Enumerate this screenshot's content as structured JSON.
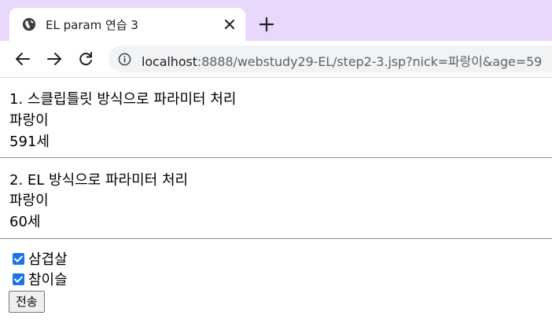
{
  "browser": {
    "tab": {
      "title": "EL param 연습 3",
      "icon": "globe-icon"
    },
    "new_tab_icon": "plus-icon",
    "nav": {
      "back_icon": "back-arrow-icon",
      "forward_icon": "forward-arrow-icon",
      "reload_icon": "reload-icon"
    },
    "address": {
      "host": "localhost",
      "rest": ":8888/webstudy29-EL/step2-3.jsp?nick=파랑이&age=59",
      "icon": "info-icon"
    }
  },
  "page": {
    "section1": {
      "heading": "1. 스클립틀릿 방식으로 파라미터 처리",
      "nick": "파랑이",
      "age": "591세"
    },
    "section2": {
      "heading": "2. EL 방식으로 파라미터 처리",
      "nick": "파랑이",
      "age": "60세"
    },
    "form": {
      "options": [
        {
          "label": "삼겹살",
          "checked": true
        },
        {
          "label": "참이슬",
          "checked": true
        }
      ],
      "submit_label": "전송"
    }
  },
  "colors": {
    "tabstrip_bg": "#e9d7fc",
    "checkbox_accent": "#1a73e8"
  }
}
